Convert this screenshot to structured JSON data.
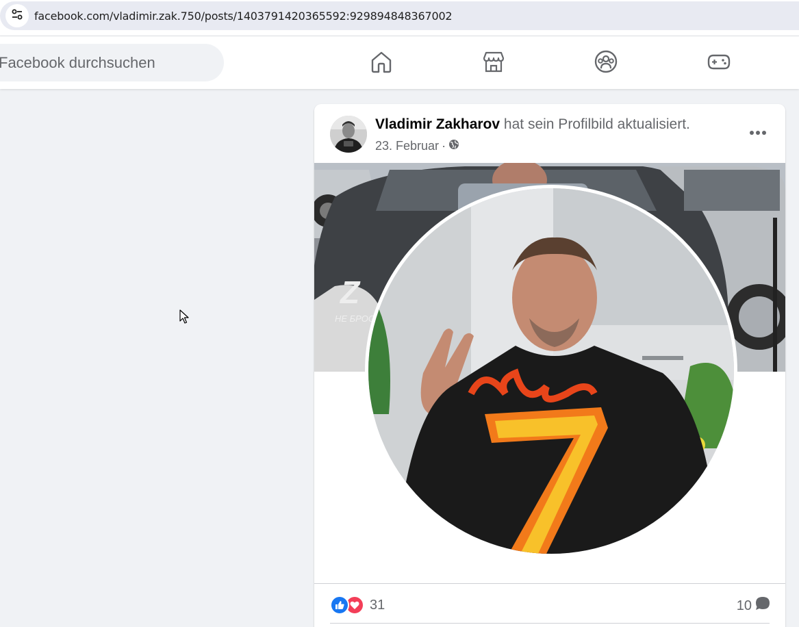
{
  "browser": {
    "url": "facebook.com/vladimir.zak.750/posts/1403791420365592:929894848367002",
    "site_info_icon": "tune-icon"
  },
  "header": {
    "search_placeholder": "Facebook durchsuchen",
    "nav_icons": [
      "home-icon",
      "marketplace-icon",
      "groups-icon",
      "gaming-icon"
    ]
  },
  "post": {
    "author": "Vladimir Zakharov",
    "action": "hat sein Profilbild aktualisiert.",
    "date": "23. Februar",
    "separator": "·",
    "privacy_icon": "globe-icon",
    "more_icon": "more-options-icon",
    "reaction_count": "31",
    "reaction_icons": [
      "like-icon",
      "love-icon"
    ],
    "comment_count": "10",
    "comment_icon": "comment-bubble-icon"
  },
  "colors": {
    "fb_background": "#f0f2f5",
    "like_blue": "#1877f2",
    "love_red": "#f33e58",
    "secondary_text": "#65676b"
  }
}
